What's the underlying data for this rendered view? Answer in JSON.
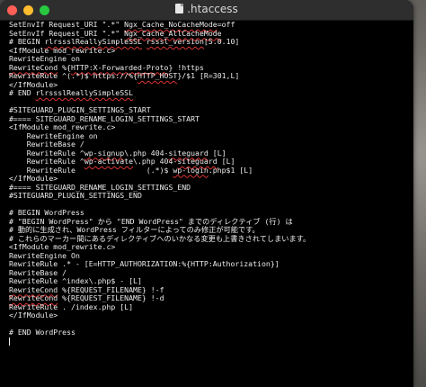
{
  "window": {
    "title": ".htaccess"
  },
  "editor": {
    "lines": [
      "SetEnvIf Request_URI \".*\" Ngx_Cache_NoCacheMode=off",
      "SetEnvIf Request_URI \".*\" Ngx_Cache_AllCacheMode",
      "# BEGIN rlrssslReallySimpleSSL rsssl_version[5.0.10]",
      "<IfModule mod_rewrite.c>",
      "RewriteEngine on",
      "RewriteCond %{HTTP:X-Forwarded-Proto} !https",
      "RewriteRule ^(.*)$ https://%{HTTP_HOST}/$1 [R=301,L]",
      "</IfModule>",
      "# END rlrssslReallySimpleSSL",
      "",
      "#SITEGUARD_PLUGIN_SETTINGS_START",
      "#==== SITEGUARD_RENAME_LOGIN_SETTINGS_START",
      "<IfModule mod_rewrite.c>",
      "    RewriteEngine on",
      "    RewriteBase /",
      "    RewriteRule ^wp-signup\\.php 404-siteguard [L]",
      "    RewriteRule ^wp-activate\\.php 404-siteguard [L]",
      "    RewriteRule                (.*)$ wp-login.php$1 [L]",
      "</IfModule>",
      "#==== SITEGUARD_RENAME_LOGIN_SETTINGS_END",
      "#SITEGUARD_PLUGIN_SETTINGS_END",
      "",
      "# BEGIN WordPress",
      "# \"BEGIN WordPress\" から \"END WordPress\" までのディレクティブ (行) は",
      "# 動的に生成され、WordPress フィルターによってのみ修正が可能です。",
      "# これらのマーカー間にあるディレクティブへのいかなる変更も上書きされてしまいます。",
      "<IfModule mod_rewrite.c>",
      "RewriteEngine On",
      "RewriteRule .* - [E=HTTP_AUTHORIZATION:%{HTTP:Authorization}]",
      "RewriteBase /",
      "RewriteRule ^index\\.php$ - [L]",
      "RewriteCond %{REQUEST_FILENAME} !-f",
      "RewriteCond %{REQUEST_FILENAME} !-d",
      "RewriteRule . /index.php [L]",
      "</IfModule>",
      "",
      "# END WordPress",
      ""
    ],
    "squiggles": [
      "Ngx_Cache_NoCacheMode",
      "Ngx_Cache_AllCacheMode",
      "rlrssslReallySimpleSSL",
      "rsssl_version",
      "RewriteCond",
      "HTTP:X-Forwarded-Proto",
      "HTTP_HOST",
      "wp-signup",
      "siteguard",
      "wp-activate",
      "wp-login"
    ],
    "cursor_line": 37
  },
  "colors": {
    "editor_background": "#000000",
    "editor_text": "#ececec",
    "spellcheck_underline": "#dd3333",
    "titlebar": "#2e2e2e",
    "close": "#ff5f57",
    "minimize": "#febc2e",
    "maximize": "#28c840"
  }
}
